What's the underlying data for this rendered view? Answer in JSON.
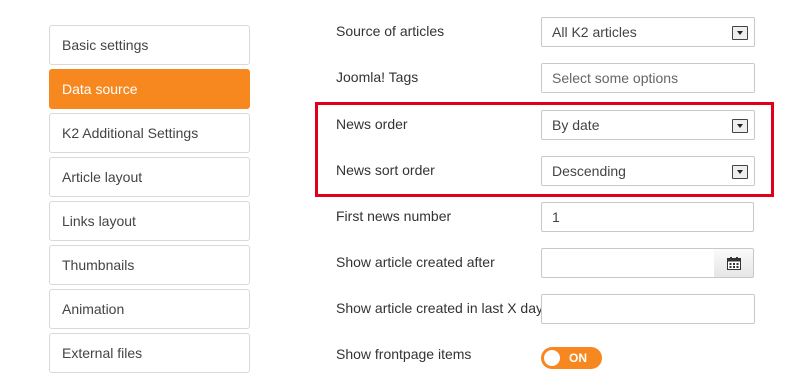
{
  "sidebar": {
    "items": [
      {
        "label": "Basic settings",
        "active": false
      },
      {
        "label": "Data source",
        "active": true
      },
      {
        "label": "K2 Additional Settings",
        "active": false
      },
      {
        "label": "Article layout",
        "active": false
      },
      {
        "label": "Links layout",
        "active": false
      },
      {
        "label": "Thumbnails",
        "active": false
      },
      {
        "label": "Animation",
        "active": false
      },
      {
        "label": "External files",
        "active": false
      }
    ]
  },
  "form": {
    "source_of_articles": {
      "label": "Source of articles",
      "value": "All K2 articles"
    },
    "joomla_tags": {
      "label": "Joomla! Tags",
      "placeholder": "Select some options"
    },
    "news_order": {
      "label": "News order",
      "value": "By date"
    },
    "news_sort_order": {
      "label": "News sort order",
      "value": "Descending"
    },
    "first_news_number": {
      "label": "First news number",
      "value": "1"
    },
    "created_after": {
      "label": "Show article created after",
      "value": ""
    },
    "created_last_days": {
      "label": "Show article created in last X days",
      "value": ""
    },
    "frontpage_items": {
      "label": "Show frontpage items",
      "toggle": "ON"
    }
  },
  "colors": {
    "accent": "#f6881f",
    "highlight": "#e1001a"
  },
  "icons": {
    "dropdown": "chevron-down-icon",
    "calendar": "calendar-icon"
  }
}
